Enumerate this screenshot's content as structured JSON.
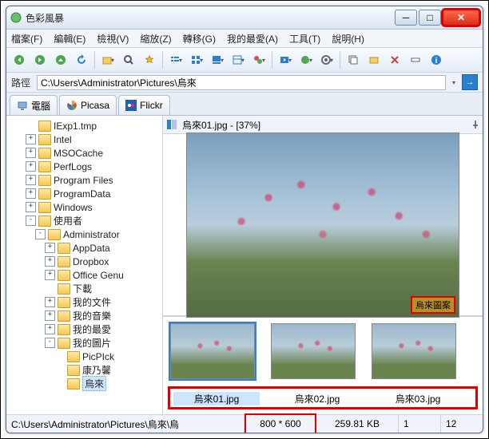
{
  "title": "色彩風暴",
  "menu": [
    "檔案(F)",
    "編輯(E)",
    "檢視(V)",
    "縮放(Z)",
    "轉移(G)",
    "我的最愛(A)",
    "工具(T)",
    "說明(H)"
  ],
  "path": {
    "label": "路徑",
    "value": "C:\\Users\\Administrator\\Pictures\\烏來"
  },
  "tabs": [
    {
      "icon": "computer",
      "label": "電腦"
    },
    {
      "icon": "picasa",
      "label": "Picasa"
    },
    {
      "icon": "flickr",
      "label": "Flickr"
    }
  ],
  "tree": [
    {
      "indent": 2,
      "exp": "",
      "label": "IExp1.tmp"
    },
    {
      "indent": 2,
      "exp": "+",
      "label": "Intel"
    },
    {
      "indent": 2,
      "exp": "+",
      "label": "MSOCache"
    },
    {
      "indent": 2,
      "exp": "+",
      "label": "PerfLogs"
    },
    {
      "indent": 2,
      "exp": "+",
      "label": "Program Files"
    },
    {
      "indent": 2,
      "exp": "+",
      "label": "ProgramData"
    },
    {
      "indent": 2,
      "exp": "+",
      "label": "Windows"
    },
    {
      "indent": 2,
      "exp": "-",
      "label": "使用者"
    },
    {
      "indent": 3,
      "exp": "-",
      "label": "Administrator"
    },
    {
      "indent": 4,
      "exp": "+",
      "label": "AppData"
    },
    {
      "indent": 4,
      "exp": "+",
      "label": "Dropbox"
    },
    {
      "indent": 4,
      "exp": "+",
      "label": "Office Genu"
    },
    {
      "indent": 4,
      "exp": "",
      "label": "下載"
    },
    {
      "indent": 4,
      "exp": "+",
      "label": "我的文件"
    },
    {
      "indent": 4,
      "exp": "+",
      "label": "我的音樂"
    },
    {
      "indent": 4,
      "exp": "+",
      "label": "我的最愛"
    },
    {
      "indent": 4,
      "exp": "-",
      "label": "我的圖片"
    },
    {
      "indent": 5,
      "exp": "",
      "label": "PicPIck"
    },
    {
      "indent": 5,
      "exp": "",
      "label": "康乃馨"
    },
    {
      "indent": 5,
      "exp": "",
      "label": "烏來",
      "sel": true
    }
  ],
  "preview": {
    "caption": "烏來01.jpg - [37%]",
    "watermark": "烏來圖案"
  },
  "thumbs": [
    {
      "name": "烏來01.jpg",
      "sel": true
    },
    {
      "name": "烏來02.jpg"
    },
    {
      "name": "烏來03.jpg"
    }
  ],
  "status": {
    "path": "C:\\Users\\Administrator\\Pictures\\烏來\\烏",
    "dims": "800 * 600",
    "size": "259.81 KB",
    "idx": "1",
    "total": "12"
  }
}
